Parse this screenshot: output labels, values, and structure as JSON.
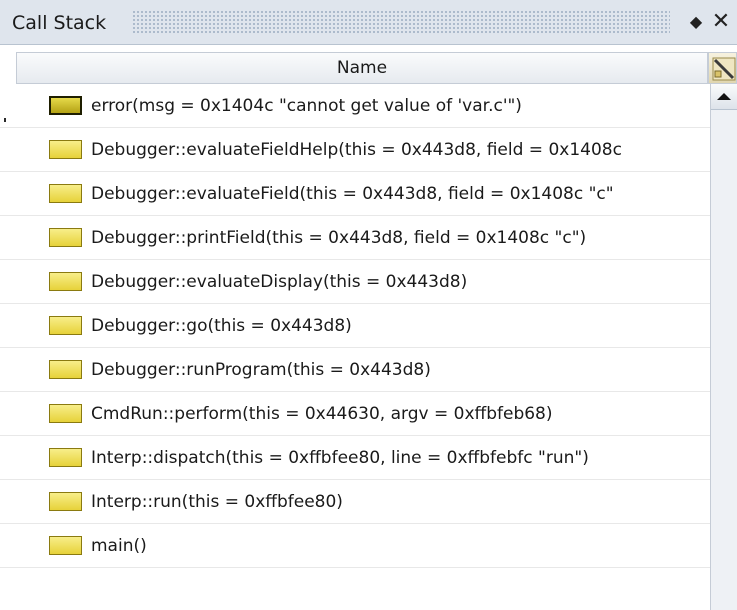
{
  "window": {
    "title": "Call Stack",
    "menu_glyph": "◆",
    "close_glyph": "✕"
  },
  "table": {
    "column_header": "Name",
    "corner_icon": "column-config-icon"
  },
  "frames": [
    {
      "label": "error(msg = 0x1404c \"cannot get value of 'var.c'\")",
      "current": true
    },
    {
      "label": "Debugger::evaluateFieldHelp(this = 0x443d8, field = 0x1408c",
      "current": false
    },
    {
      "label": "Debugger::evaluateField(this = 0x443d8, field = 0x1408c \"c\"",
      "current": false
    },
    {
      "label": "Debugger::printField(this = 0x443d8, field = 0x1408c \"c\")",
      "current": false
    },
    {
      "label": "Debugger::evaluateDisplay(this = 0x443d8)",
      "current": false
    },
    {
      "label": "Debugger::go(this = 0x443d8)",
      "current": false
    },
    {
      "label": "Debugger::runProgram(this = 0x443d8)",
      "current": false
    },
    {
      "label": "CmdRun::perform(this = 0x44630, argv = 0xffbfeb68)",
      "current": false
    },
    {
      "label": "Interp::dispatch(this = 0xffbfee80, line = 0xffbfebfc \"run\")",
      "current": false
    },
    {
      "label": "Interp::run(this = 0xffbfee80)",
      "current": false
    },
    {
      "label": "main()",
      "current": false
    }
  ],
  "colors": {
    "titlebar": "#dfe5ed",
    "frame_icon": "#e7d23a",
    "frame_icon_current": "#b4a214"
  }
}
